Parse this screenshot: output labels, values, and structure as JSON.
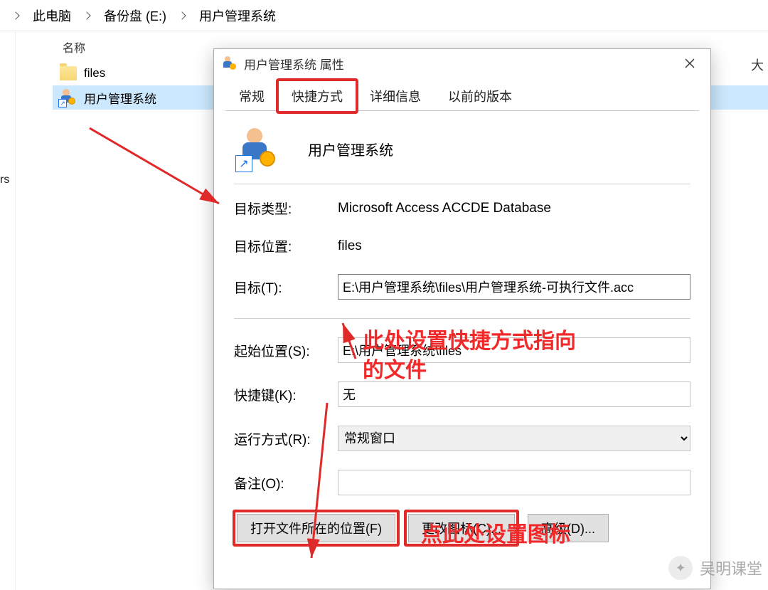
{
  "breadcrumb": {
    "items": [
      "此电脑",
      "备份盘 (E:)",
      "用户管理系统"
    ]
  },
  "explorer": {
    "column_name_header": "名称",
    "side_label": "rs",
    "right_edge_label": "大",
    "files": [
      {
        "name": "files",
        "type": "folder"
      },
      {
        "name": "用户管理系统",
        "type": "shortcut"
      }
    ]
  },
  "dialog": {
    "title": "用户管理系统 属性",
    "tabs": [
      "常规",
      "快捷方式",
      "详细信息",
      "以前的版本"
    ],
    "active_tab_index": 1,
    "app_name": "用户管理系统",
    "fields": {
      "target_type_label": "目标类型:",
      "target_type_value": "Microsoft Access ACCDE Database",
      "target_location_label": "目标位置:",
      "target_location_value": "files",
      "target_label": "目标(T):",
      "target_value": "E:\\用户管理系统\\files\\用户管理系统-可执行文件.acc",
      "start_in_label": "起始位置(S):",
      "start_in_value": "E:\\用户管理系统\\files",
      "shortcut_key_label": "快捷键(K):",
      "shortcut_key_value": "无",
      "run_label": "运行方式(R):",
      "run_value": "常规窗口",
      "comment_label": "备注(O):",
      "comment_value": ""
    },
    "buttons": {
      "open_location": "打开文件所在的位置(F)",
      "change_icon": "更改图标(C)...",
      "advanced": "高级(D)..."
    }
  },
  "annotations": {
    "target_hint_line1": "此处设置快捷方式指向",
    "target_hint_line2": "的文件",
    "icon_hint": "点此处设置图标"
  },
  "watermark": {
    "text": "吴明课堂"
  }
}
